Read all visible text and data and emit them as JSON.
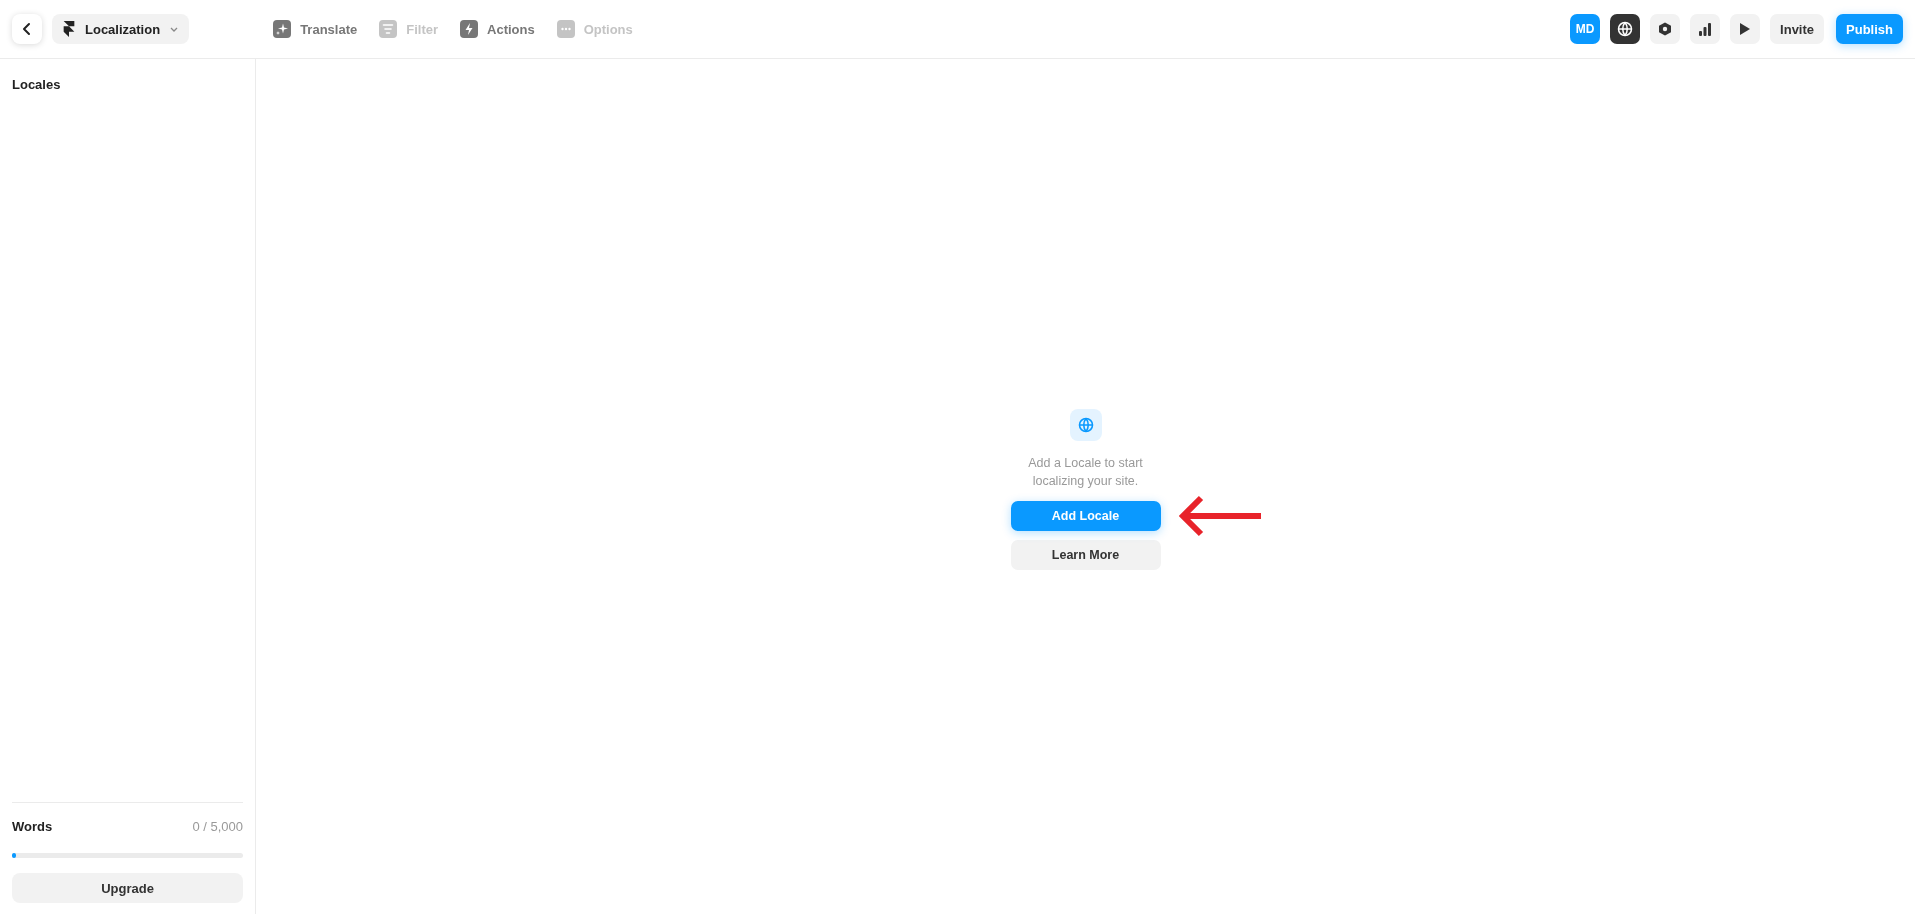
{
  "header": {
    "project": "Localization",
    "tools": [
      {
        "label": "Translate",
        "kind": "sparkle",
        "disabled": false
      },
      {
        "label": "Filter",
        "kind": "filter",
        "disabled": true
      },
      {
        "label": "Actions",
        "kind": "bolt",
        "disabled": false
      },
      {
        "label": "Options",
        "kind": "dots",
        "disabled": true
      }
    ],
    "avatar": "MD",
    "icon_buttons": [
      {
        "kind": "globe",
        "selected": true
      },
      {
        "kind": "hexagon",
        "selected": false
      },
      {
        "kind": "chart",
        "selected": false
      },
      {
        "kind": "play",
        "selected": false
      }
    ],
    "invite": "Invite",
    "publish": "Publish"
  },
  "sidebar": {
    "title": "Locales",
    "usage_label": "Words",
    "usage_value": "0 / 5,000",
    "level": 0,
    "upgrade": "Upgrade"
  },
  "empty_state": {
    "message": "Add a Locale to start localizing your site.",
    "primary": "Add Locale",
    "secondary": "Learn More"
  }
}
